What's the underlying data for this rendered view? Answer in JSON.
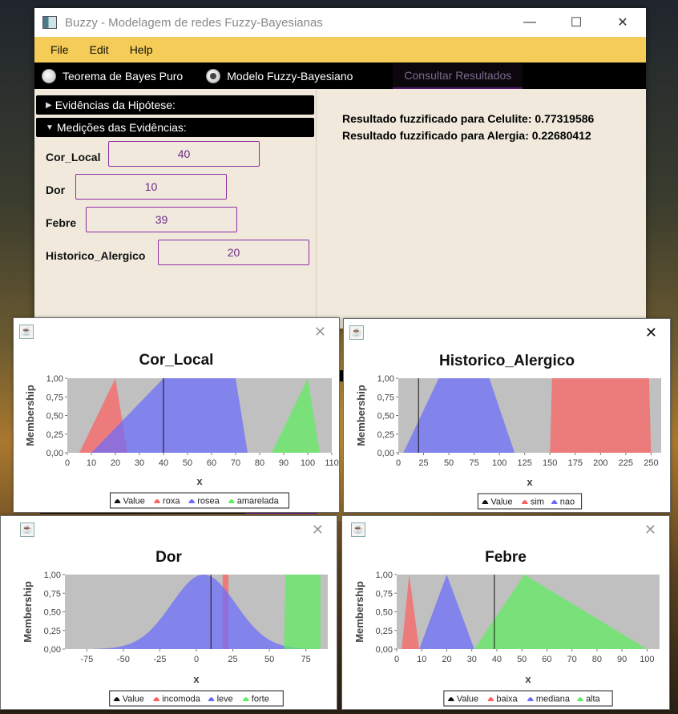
{
  "window": {
    "title": "Buzzy - Modelagem de redes Fuzzy-Bayesianas",
    "minimize": "—",
    "maximize": "☐",
    "close": "✕"
  },
  "menu": {
    "file": "File",
    "edit": "Edit",
    "help": "Help"
  },
  "modes": {
    "bayes": "Teorema de Bayes Puro",
    "fuzzy": "Modelo Fuzzy-Bayesiano",
    "selected": "Modelo Fuzzy-Bayesiano",
    "consult": "Consultar Resultados"
  },
  "panels": {
    "hipotese": "Evidências da Hipótese:",
    "medicoes": "Medições das Evidências:"
  },
  "fields": [
    {
      "label": "Cor_Local",
      "value": "40"
    },
    {
      "label": "Dor",
      "value": "10"
    },
    {
      "label": "Febre",
      "value": "39"
    },
    {
      "label": "Historico_Alergico",
      "value": "20"
    }
  ],
  "results": [
    "Resultado fuzzificado para Celulite: 0.77319586",
    "Resultado fuzzificado para Alergia: 0.22680412"
  ],
  "chart_data": [
    {
      "type": "area",
      "title": "Cor_Local",
      "xlabel": "x",
      "ylabel": "Membership",
      "xlim": [
        0,
        110
      ],
      "ylim": [
        0,
        1
      ],
      "xticks": [
        "0",
        "10",
        "20",
        "30",
        "40",
        "50",
        "60",
        "70",
        "80",
        "90",
        "100",
        "110"
      ],
      "yticks": [
        "0,00",
        "0,25",
        "0,50",
        "0,75",
        "1,00"
      ],
      "value": 40,
      "series": [
        {
          "name": "roxa",
          "color": "#ff5f5f",
          "points": [
            [
              5,
              0
            ],
            [
              20,
              1
            ],
            [
              25,
              0
            ]
          ]
        },
        {
          "name": "rosea",
          "color": "#6a6aff",
          "points": [
            [
              10,
              0
            ],
            [
              40,
              1
            ],
            [
              70,
              1
            ],
            [
              75,
              0
            ]
          ]
        },
        {
          "name": "amarelada",
          "color": "#5cf05c",
          "points": [
            [
              85,
              0
            ],
            [
              100,
              1
            ],
            [
              105,
              0
            ]
          ]
        }
      ],
      "legend": [
        "Value",
        "roxa",
        "rosea",
        "amarelada"
      ]
    },
    {
      "type": "area",
      "title": "Historico_Alergico",
      "xlabel": "x",
      "ylabel": "Membership",
      "xlim": [
        0,
        260
      ],
      "ylim": [
        0,
        1
      ],
      "xticks": [
        "0",
        "25",
        "50",
        "75",
        "100",
        "125",
        "150",
        "175",
        "200",
        "225",
        "250"
      ],
      "yticks": [
        "0,00",
        "0,25",
        "0,50",
        "0,75",
        "1,00"
      ],
      "value": 20,
      "series": [
        {
          "name": "sim",
          "color": "#ff5f5f",
          "points": [
            [
              150,
              0
            ],
            [
              152,
              1
            ],
            [
              248,
              1
            ],
            [
              250,
              0
            ]
          ]
        },
        {
          "name": "nao",
          "color": "#6a6aff",
          "points": [
            [
              5,
              0
            ],
            [
              40,
              1
            ],
            [
              90,
              1
            ],
            [
              115,
              0
            ]
          ]
        }
      ],
      "legend": [
        "Value",
        "sim",
        "nao"
      ]
    },
    {
      "type": "area",
      "title": "Dor",
      "xlabel": "x",
      "ylabel": "Membership",
      "xlim": [
        -90,
        90
      ],
      "ylim": [
        0,
        1
      ],
      "xticks": [
        "-75",
        "-50",
        "-25",
        "0",
        "25",
        "50",
        "75"
      ],
      "yticks": [
        "0,00",
        "0,25",
        "0,50",
        "0,75",
        "1,00"
      ],
      "value": 10,
      "series": [
        {
          "name": "incomoda",
          "color": "#ff5f5f",
          "points": [
            [
              18,
              0
            ],
            [
              18,
              1
            ],
            [
              22,
              1
            ],
            [
              22,
              0
            ]
          ]
        },
        {
          "name": "leve",
          "color": "#6a6aff",
          "gaussian": {
            "mean": 5,
            "sigma": 22,
            "from": -70,
            "to": 75
          }
        },
        {
          "name": "forte",
          "color": "#5cf05c",
          "points": [
            [
              60,
              0
            ],
            [
              61,
              1
            ],
            [
              85,
              1
            ],
            [
              85,
              0
            ]
          ]
        }
      ],
      "legend": [
        "Value",
        "incomoda",
        "leve",
        "forte"
      ]
    },
    {
      "type": "area",
      "title": "Febre",
      "xlabel": "x",
      "ylabel": "Membership",
      "xlim": [
        0,
        105
      ],
      "ylim": [
        0,
        1
      ],
      "xticks": [
        "0",
        "10",
        "20",
        "30",
        "40",
        "50",
        "60",
        "70",
        "80",
        "90",
        "100"
      ],
      "yticks": [
        "0,00",
        "0,25",
        "0,50",
        "0,75",
        "1,00"
      ],
      "value": 39,
      "series": [
        {
          "name": "baixa",
          "color": "#ff5f5f",
          "points": [
            [
              2,
              0
            ],
            [
              5,
              1
            ],
            [
              9,
              0
            ]
          ]
        },
        {
          "name": "mediana",
          "color": "#6a6aff",
          "points": [
            [
              9,
              0
            ],
            [
              20,
              1
            ],
            [
              31,
              0
            ]
          ]
        },
        {
          "name": "alta",
          "color": "#5cf05c",
          "points": [
            [
              31,
              0
            ],
            [
              51,
              1
            ],
            [
              100,
              0
            ]
          ]
        }
      ],
      "legend": [
        "Value",
        "baixa",
        "mediana",
        "alta"
      ]
    }
  ]
}
